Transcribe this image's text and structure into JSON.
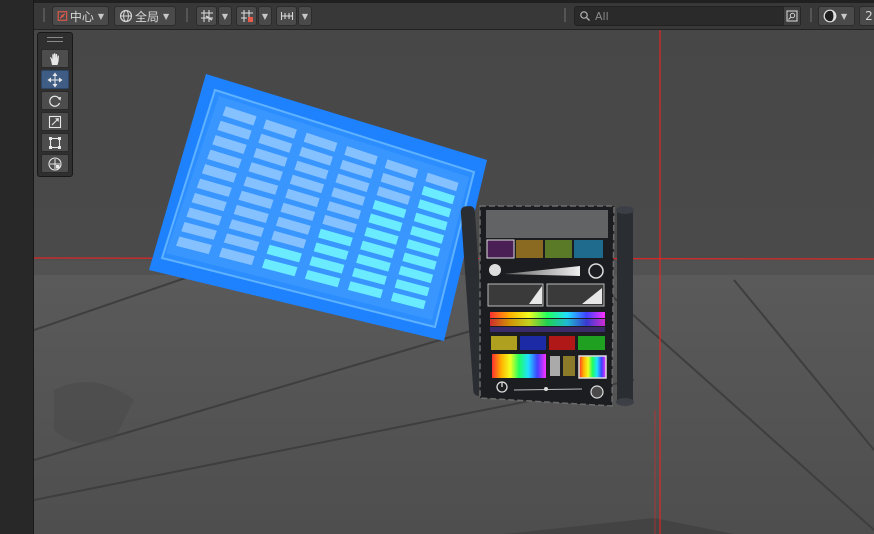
{
  "toolbar": {
    "pivot_label": "中心",
    "handle_label": "全局",
    "search": {
      "placeholder": "All",
      "value": ""
    },
    "overflow_label": "2"
  },
  "tools": {
    "items": [
      {
        "name": "hand-tool",
        "icon": "hand-icon",
        "active": false
      },
      {
        "name": "move-tool",
        "icon": "move-icon",
        "active": true
      },
      {
        "name": "rotate-tool",
        "icon": "rotate-icon",
        "active": false
      },
      {
        "name": "scale-tool",
        "icon": "scale-icon",
        "active": false
      },
      {
        "name": "rect-tool",
        "icon": "rect-transform-icon",
        "active": false
      },
      {
        "name": "transform-tool",
        "icon": "transform-icon",
        "active": false
      }
    ]
  },
  "colors": {
    "accent": "#3f5d84",
    "axis": "#ff1e1e",
    "panel_blue": "#1e82ff",
    "keycap": "#7ff0ff"
  }
}
